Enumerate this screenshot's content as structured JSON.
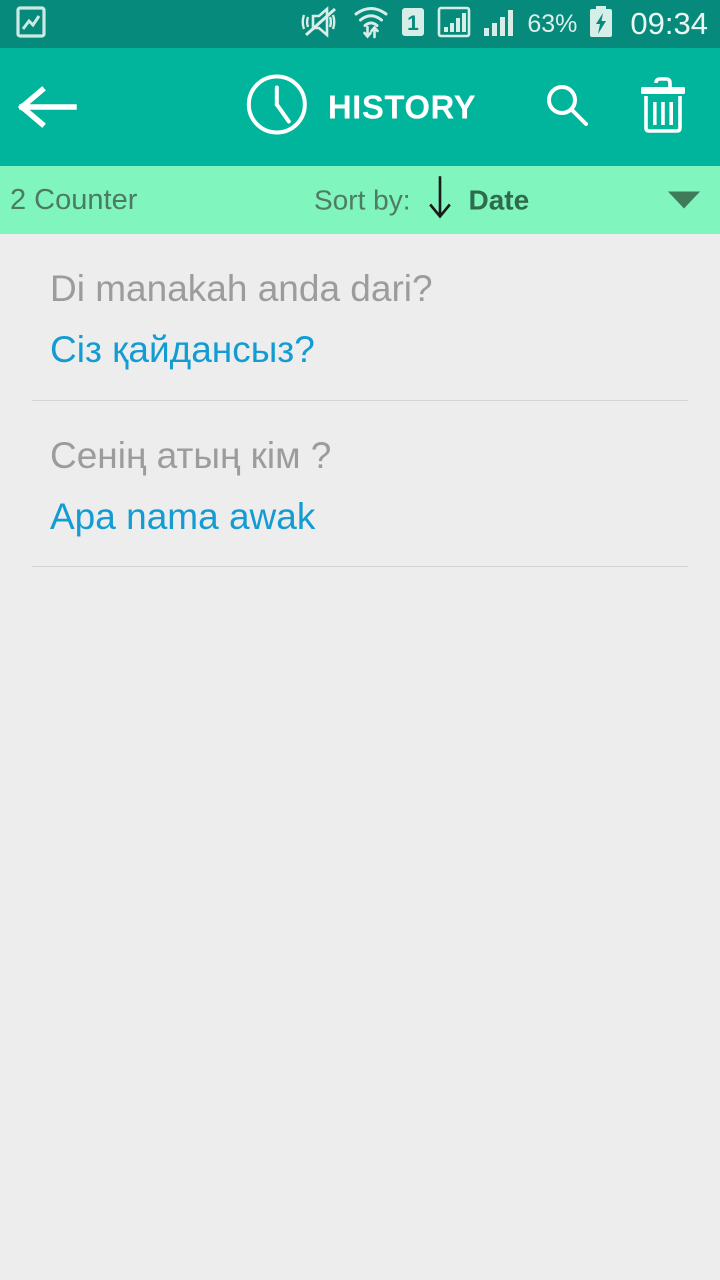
{
  "status_bar": {
    "icons": [
      "picture-icon",
      "vibrate-mute-icon",
      "wifi-transfer-icon",
      "sim1-icon",
      "signal-boxed-icon",
      "signal-bars-icon"
    ],
    "sim_label": "1",
    "battery_percent": "63%",
    "battery_state": "charging",
    "time": "09:34",
    "background": "#068A7B"
  },
  "app_bar": {
    "back_label": "Back",
    "clock_icon": "clock-icon",
    "title": "HISTORY",
    "search_label": "Search",
    "delete_label": "Delete",
    "background": "#00B59B",
    "text_color": "#FFFFFF"
  },
  "sort_bar": {
    "counter": "2 Counter",
    "sort_by_label": "Sort by:",
    "sort_direction": "descending",
    "sort_value": "Date",
    "background": "#80F5BE",
    "accent": "#2E6B4C"
  },
  "history": {
    "items": [
      {
        "source_text": "Di manakah anda dari?",
        "target_text": "Сіз қайдансыз?"
      },
      {
        "source_text": "Сенің атың кім ?",
        "target_text": "Apa nama awak"
      }
    ],
    "source_color": "#9C9C9C",
    "target_color": "#139CD3",
    "background": "#EDEDED"
  }
}
